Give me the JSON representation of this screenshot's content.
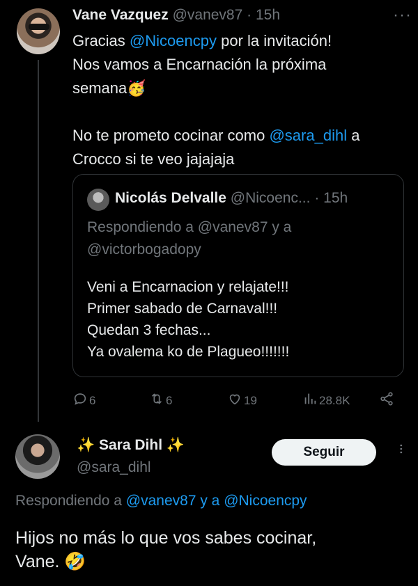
{
  "tweet": {
    "display_name": "Vane Vazquez",
    "handle": "@vanev87",
    "separator": "·",
    "time": "15h",
    "more": "···",
    "text_p1_a": "Gracias ",
    "text_p1_mention": "@Nicoencpy",
    "text_p1_b": " por la invitación!",
    "text_p2": "Nos vamos a Encarnación la próxima",
    "text_p3": "semana🥳",
    "text_p4_a": "No te prometo cocinar como ",
    "text_p4_mention": "@sara_dihl",
    "text_p4_b": " a",
    "text_p5": "Crocco si te veo jajajaja"
  },
  "quote": {
    "display_name": "Nicolás Delvalle",
    "handle": "@Nicoenc...",
    "separator": "·",
    "time": "15h",
    "reply_line1": "Respondiendo a @vanev87 y a",
    "reply_line2": "@victorbogadopy",
    "lines": [
      "Veni a Encarnacion y relajate!!!",
      "Primer sabado de Carnaval!!!",
      "Quedan 3 fechas...",
      "Ya ovalema ko de Plagueo!!!!!!!"
    ]
  },
  "actions": {
    "replies": "6",
    "retweets": "6",
    "likes": "19",
    "views": "28.8K"
  },
  "reply": {
    "sparkle_left": "✨",
    "display_name": " Sara Dihl ",
    "sparkle_right": "✨",
    "handle": "@sara_dihl",
    "follow_label": "Seguir",
    "more": "···",
    "context_prefix": "Respondiendo a ",
    "context_mentions": "@vanev87 y a @Nicoencpy",
    "text_line1": "Hijos no más lo que vos sabes cocinar,",
    "text_line2": "Vane. 🤣"
  },
  "icons": {
    "reply": "reply-icon",
    "retweet": "retweet-icon",
    "like": "heart-icon",
    "views": "views-icon",
    "share": "share-icon"
  }
}
